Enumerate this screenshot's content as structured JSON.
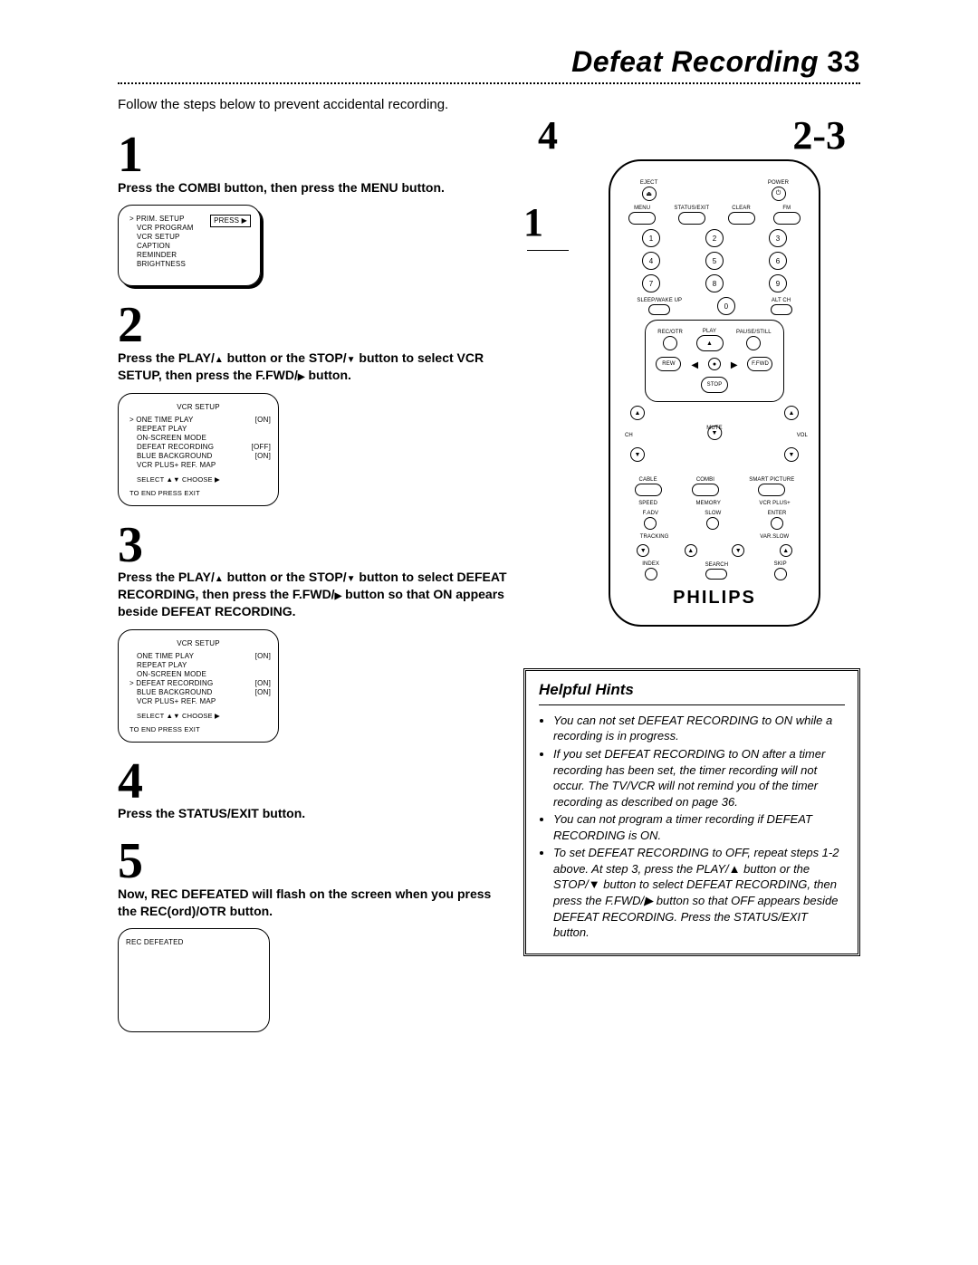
{
  "header": {
    "title": "Defeat Recording",
    "page": "33"
  },
  "intro": "Follow the steps below to prevent accidental recording.",
  "steps": {
    "s1": {
      "num": "1",
      "text": "Press the COMBI button, then press the MENU button.",
      "screen": {
        "lines": [
          "PRIM. SETUP",
          "VCR PROGRAM",
          "VCR SETUP",
          "CAPTION",
          "REMINDER",
          "BRIGHTNESS"
        ],
        "cursor_index": 0,
        "button": "PRESS ▶"
      }
    },
    "s2": {
      "num": "2",
      "text_parts": [
        "Press the PLAY/",
        " button or the STOP/",
        " button to select VCR SETUP, then press the F.FWD/",
        " button."
      ],
      "screen": {
        "title": "VCR SETUP",
        "rows": [
          {
            "label": "ONE TIME PLAY",
            "val": "[ON]"
          },
          {
            "label": "REPEAT PLAY",
            "val": ""
          },
          {
            "label": "ON-SCREEN MODE",
            "val": ""
          },
          {
            "label": "DEFEAT RECORDING",
            "val": "[OFF]"
          },
          {
            "label": "BLUE BACKGROUND",
            "val": "[ON]"
          },
          {
            "label": "VCR PLUS+ REF. MAP",
            "val": ""
          }
        ],
        "cursor_index": 0,
        "foot1": "SELECT ▲▼ CHOOSE ▶",
        "foot2": "TO END PRESS EXIT"
      }
    },
    "s3": {
      "num": "3",
      "text_parts": [
        "Press the PLAY/",
        " button or the STOP/",
        " button to select DEFEAT RECORDING, then press the F.FWD/",
        " button so that ON appears beside DEFEAT RECORDING."
      ],
      "screen": {
        "title": "VCR SETUP",
        "rows": [
          {
            "label": "ONE TIME PLAY",
            "val": "[ON]"
          },
          {
            "label": "REPEAT PLAY",
            "val": ""
          },
          {
            "label": "ON-SCREEN MODE",
            "val": ""
          },
          {
            "label": "DEFEAT RECORDING",
            "val": "[ON]"
          },
          {
            "label": "BLUE BACKGROUND",
            "val": "[ON]"
          },
          {
            "label": "VCR PLUS+ REF. MAP",
            "val": ""
          }
        ],
        "cursor_index": 3,
        "foot1": "SELECT ▲▼ CHOOSE ▶",
        "foot2": "TO END PRESS EXIT"
      }
    },
    "s4": {
      "num": "4",
      "text": "Press the STATUS/EXIT button."
    },
    "s5": {
      "num": "5",
      "text": "Now, REC DEFEATED will flash on the screen when you press the REC(ord)/OTR button.",
      "screen_line": "REC DEFEATED"
    }
  },
  "remote": {
    "callouts": {
      "top_left": "4",
      "top_right": "2-3",
      "side": "1"
    },
    "labels": {
      "eject": "EJECT",
      "power": "POWER",
      "menu": "MENU",
      "status": "STATUS/EXIT",
      "clear": "CLEAR",
      "fm": "FM",
      "sleep": "SLEEP/WAKE UP",
      "altch": "ALT CH",
      "rec": "REC/OTR",
      "play": "PLAY",
      "pause": "PAUSE/STILL",
      "rew": "REW",
      "ffwd": "F.FWD",
      "stop": "STOP",
      "ch": "CH",
      "mute": "MUTE",
      "vol": "VOL",
      "cable": "CABLE",
      "combi": "COMBI",
      "smart": "SMART PICTURE",
      "speed": "SPEED",
      "memory": "MEMORY",
      "vcrplus": "VCR PLUS+",
      "fadv": "F.ADV",
      "slow": "SLOW",
      "enter": "ENTER",
      "tracking": "TRACKING",
      "varslow": "VAR.SLOW",
      "index": "INDEX",
      "search": "SEARCH",
      "skip": "SKIP"
    },
    "numbers": [
      "1",
      "2",
      "3",
      "4",
      "5",
      "6",
      "7",
      "8",
      "9",
      "0"
    ],
    "brand": "PHILIPS"
  },
  "hints": {
    "title": "Helpful Hints",
    "items": [
      "You can not set DEFEAT RECORDING to ON while a recording is in progress.",
      "If you set DEFEAT RECORDING to ON after a timer recording has been set, the timer recording will not occur. The TV/VCR will not remind you of the timer recording as described on page 36.",
      "You can not program a timer recording if DEFEAT RECORDING is ON.",
      "To set DEFEAT RECORDING to OFF, repeat steps 1-2 above. At step 3, press the PLAY/▲ button or the STOP/▼ button to select DEFEAT RECORDING, then press the F.FWD/▶ button so that OFF appears beside DEFEAT RECORDING. Press the STATUS/EXIT button."
    ]
  }
}
